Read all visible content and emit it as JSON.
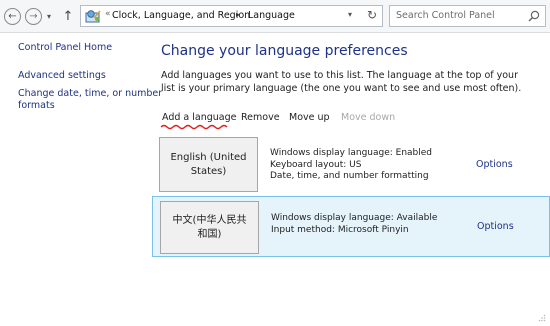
{
  "address_bar": {
    "breadcrumb_overflow": "«",
    "crumb1": "Clock, Language, and Region",
    "crumb_separator": "▸",
    "crumb2": "Language",
    "search_placeholder": "Search Control Panel"
  },
  "sidebar": {
    "items": [
      {
        "label": "Control Panel Home"
      },
      {
        "label": "Advanced settings"
      },
      {
        "label": "Change date, time, or number"
      },
      {
        "label": "formats"
      }
    ]
  },
  "main": {
    "title": "Change your language preferences",
    "description": "Add languages you want to use to this list. The language at the top of your list is your primary language (the one you want to see and use most often).",
    "toolbar": {
      "add": "Add a language",
      "remove": "Remove",
      "move_up": "Move up",
      "move_down": "Move down"
    },
    "languages": [
      {
        "name_line1": "English (United",
        "name_line2": "States)",
        "details": [
          "Windows display language: Enabled",
          "Keyboard layout: US",
          "Date, time, and number formatting"
        ],
        "options": "Options"
      },
      {
        "name_line1": "中文(中华人民共",
        "name_line2": "和国)",
        "details": [
          "Windows display language: Available",
          "Input method: Microsoft Pinyin"
        ],
        "options": "Options"
      }
    ]
  },
  "colors": {
    "link": "#1e3287",
    "selection_bg": "#e5f3fb",
    "selection_border": "#7cc1ec",
    "annotation_underline": "#e02020"
  }
}
